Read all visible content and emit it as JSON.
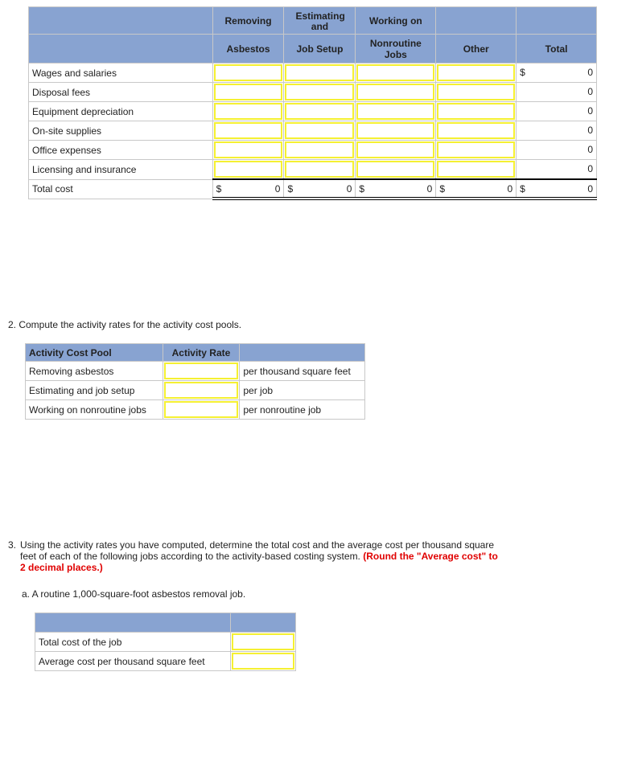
{
  "part1": {
    "header_row1": [
      "",
      "Removing",
      "Estimating and",
      "Working on",
      "",
      ""
    ],
    "header_row2": [
      "",
      "Asbestos",
      "Job Setup",
      "Nonroutine Jobs",
      "Other",
      "Total"
    ],
    "rows": [
      {
        "label": "Wages and salaries",
        "total_currency": "$",
        "total": "0"
      },
      {
        "label": "Disposal fees",
        "total_currency": "",
        "total": "0"
      },
      {
        "label": "Equipment depreciation",
        "total_currency": "",
        "total": "0"
      },
      {
        "label": "On-site supplies",
        "total_currency": "",
        "total": "0"
      },
      {
        "label": "Office expenses",
        "total_currency": "",
        "total": "0"
      },
      {
        "label": "Licensing and insurance",
        "total_currency": "",
        "total": "0"
      }
    ],
    "total_row": {
      "label": "Total cost",
      "currency": "$",
      "asbestos": "0",
      "job_setup": "0",
      "nonroutine": "0",
      "other": "0",
      "total": "0"
    }
  },
  "part2": {
    "question": "2.  Compute the activity rates for the activity cost pools.",
    "headers": [
      "Activity Cost Pool",
      "Activity Rate",
      ""
    ],
    "rows": [
      {
        "pool": "Removing asbestos",
        "rate": "",
        "unit": "per thousand square feet"
      },
      {
        "pool": "Estimating and job setup",
        "rate": "",
        "unit": "per job"
      },
      {
        "pool": "Working on nonroutine jobs",
        "rate": "",
        "unit": "per nonroutine job"
      }
    ]
  },
  "part3": {
    "number": "3.",
    "question": "Using the activity rates you have computed, determine the total cost and the average cost per thousand square feet of each of the following jobs according to the activity-based costing system.",
    "note": "(Round the \"Average cost\" to 2 decimal places.)",
    "sub_a": "a.  A routine 1,000-square-foot asbestos removal job.",
    "rows": [
      {
        "label": "Total cost of the job",
        "value": ""
      },
      {
        "label": "Average cost per thousand square feet",
        "value": ""
      }
    ]
  },
  "colors": {
    "header_bg": "#88a3d1",
    "input_border": "#f5f032",
    "note_red": "#e00000"
  }
}
